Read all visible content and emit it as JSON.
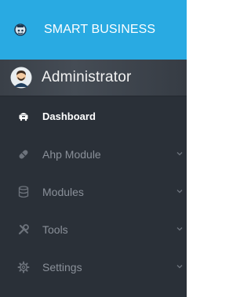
{
  "brand": {
    "title": "SMART BUSINESS",
    "color": "#29aae2"
  },
  "profile": {
    "name": "Administrator"
  },
  "menu": {
    "items": [
      {
        "label": "Dashboard",
        "icon": "dashboard-icon",
        "active": true
      },
      {
        "label": "Ahp Module",
        "icon": "pill-icon",
        "has_submenu": true
      },
      {
        "label": "Modules",
        "icon": "database-icon",
        "has_submenu": true
      },
      {
        "label": "Tools",
        "icon": "tools-icon",
        "has_submenu": true
      },
      {
        "label": "Settings",
        "icon": "gear-icon",
        "has_submenu": true
      }
    ]
  },
  "colors": {
    "sidebar_bg": "#2a3038",
    "text_muted": "#8a9099",
    "text_active": "#ffffff"
  }
}
